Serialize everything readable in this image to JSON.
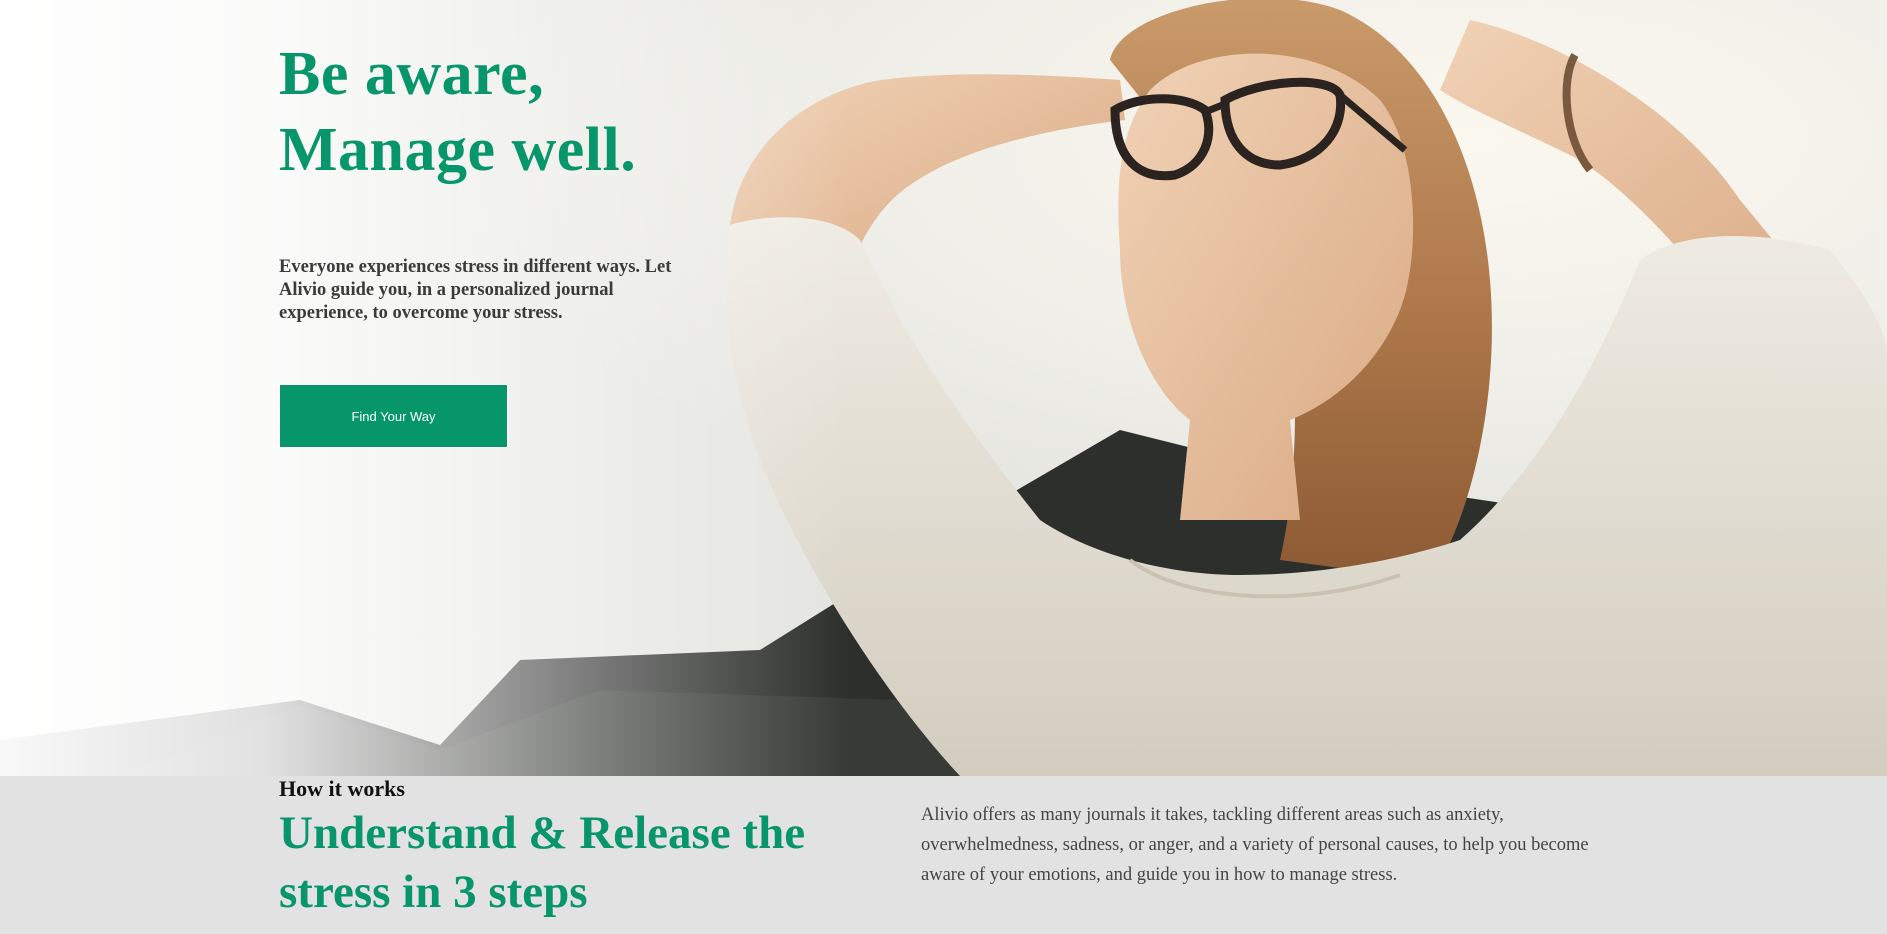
{
  "hero": {
    "title_line1": "Be aware,",
    "title_line2": "Manage well.",
    "subtitle": "Everyone experiences stress in different ways. Let Alivio guide you, in a personalized journal experience, to overcome your stress.",
    "cta_label": "Find Your Way",
    "image": "woman-relaxing-sunlight-photo"
  },
  "how_it_works": {
    "label": "How it works",
    "title": "Understand & Release the stress in 3 steps",
    "description": "Alivio offers as many journals it takes, tackling different areas such as anxiety, overwhelmedness, sadness, or anger, and a variety of personal causes, to help you become aware of your emotions, and guide you in how to manage stress."
  },
  "colors": {
    "brand_green": "#07966a",
    "section_bg": "#e2e2e2",
    "body_text": "#3b3b3b"
  }
}
